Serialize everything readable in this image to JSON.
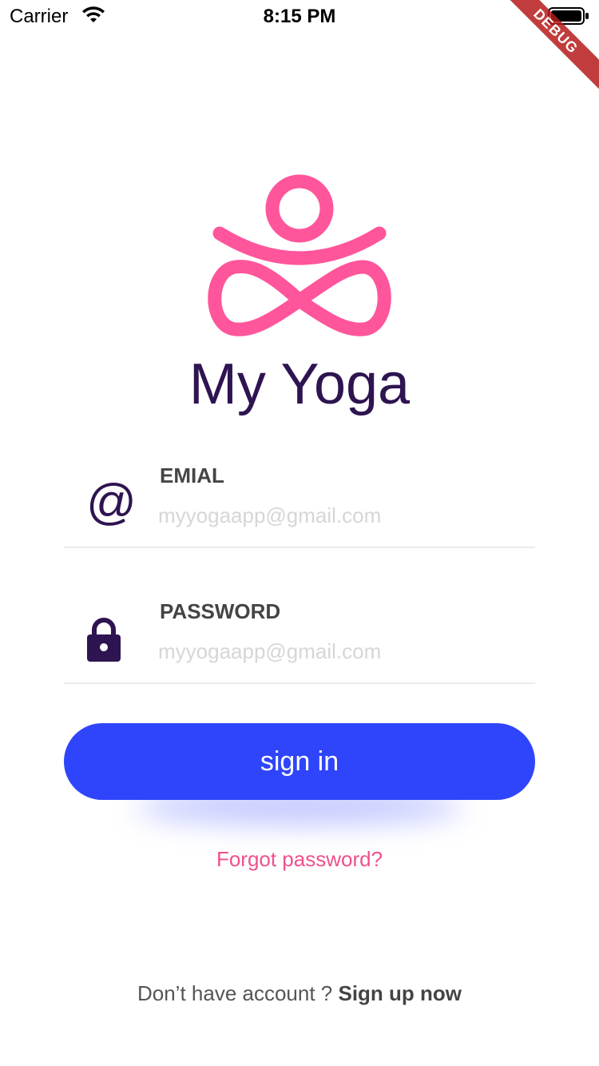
{
  "status_bar": {
    "carrier": "Carrier",
    "time": "8:15 PM",
    "wifi_icon": "wifi-icon",
    "battery_icon": "battery-icon"
  },
  "debug_banner": "DEBUG",
  "logo": {
    "icon": "yoga-pose-icon",
    "color": "#ff559b"
  },
  "app_title": "My Yoga",
  "email_field": {
    "icon": "at-icon",
    "icon_text": "@",
    "label": "EMIAL",
    "placeholder": "myyogaapp@gmail.com",
    "value": ""
  },
  "password_field": {
    "icon": "lock-icon",
    "label": "PASSWORD",
    "placeholder": "myyogaapp@gmail.com",
    "value": ""
  },
  "sign_in_button": {
    "label": "sign in",
    "color": "#2f45fb"
  },
  "forgot_password": "Forgot password?",
  "signup": {
    "prompt": "Don’t have account ? ",
    "link": "Sign up now"
  },
  "colors": {
    "title": "#2e1450",
    "accent_pink": "#f0508e",
    "primary_blue": "#2f45fb"
  }
}
